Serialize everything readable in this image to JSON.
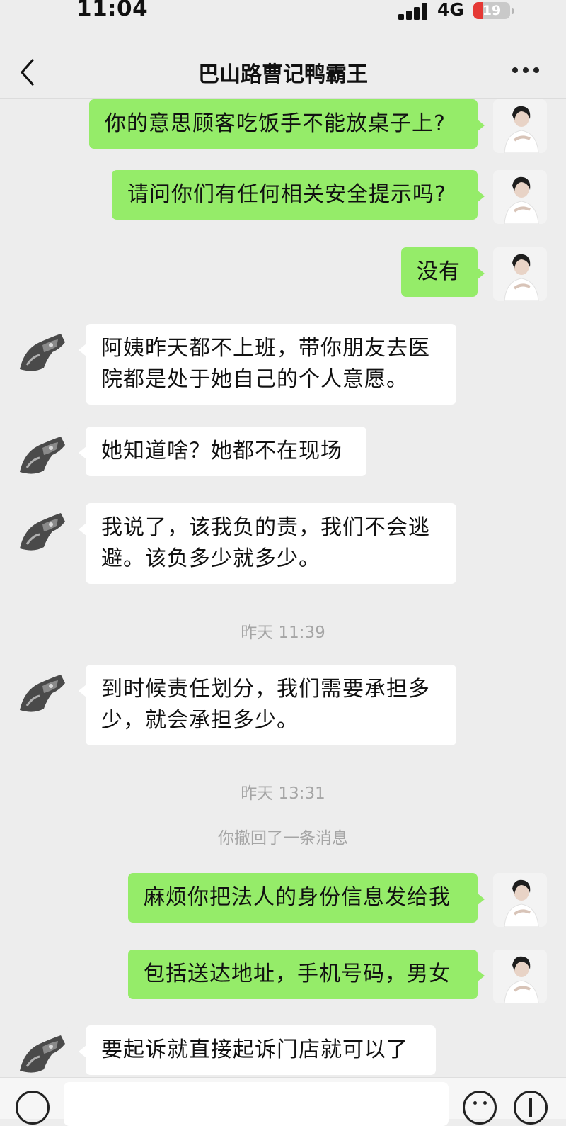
{
  "status_bar": {
    "time": "11:04",
    "network": "4G",
    "battery": "19"
  },
  "header": {
    "title": "巴山路曹记鸭霸王",
    "back_icon": "chevron-left-icon",
    "more_icon": "more-dots-icon"
  },
  "messages": [
    {
      "type": "message",
      "sender": "self",
      "text": "你的意思顾客吃饭手不能放桌子上?"
    },
    {
      "type": "message",
      "sender": "self",
      "text": "请问你们有任何相关安全提示吗?"
    },
    {
      "type": "message",
      "sender": "self",
      "text": "没有"
    },
    {
      "type": "message",
      "sender": "other",
      "text": "阿姨昨天都不上班，带你朋友去医院都是处于她自己的个人意愿。"
    },
    {
      "type": "message",
      "sender": "other",
      "text": "她知道啥？她都不在现场"
    },
    {
      "type": "message",
      "sender": "other",
      "text": "我说了，该我负的责，我们不会逃避。该负多少就多少。"
    },
    {
      "type": "timestamp",
      "text": "昨天 11:39"
    },
    {
      "type": "message",
      "sender": "other",
      "text": "到时候责任划分，我们需要承担多少，就会承担多少。"
    },
    {
      "type": "timestamp",
      "text": "昨天 13:31"
    },
    {
      "type": "system",
      "text": "你撤回了一条消息"
    },
    {
      "type": "message",
      "sender": "self",
      "text": "麻烦你把法人的身份信息发给我"
    },
    {
      "type": "message",
      "sender": "self",
      "text": "包括送达地址，手机号码，男女"
    },
    {
      "type": "message",
      "sender": "other",
      "text": "要起诉就直接起诉门店就可以了"
    }
  ],
  "input_bar": {
    "voice_icon": "voice-icon",
    "emoji_icon": "emoji-icon",
    "plus_icon": "plus-icon"
  },
  "colors": {
    "self_bubble": "#95ec69",
    "other_bubble": "#ffffff",
    "background": "#ededed"
  }
}
